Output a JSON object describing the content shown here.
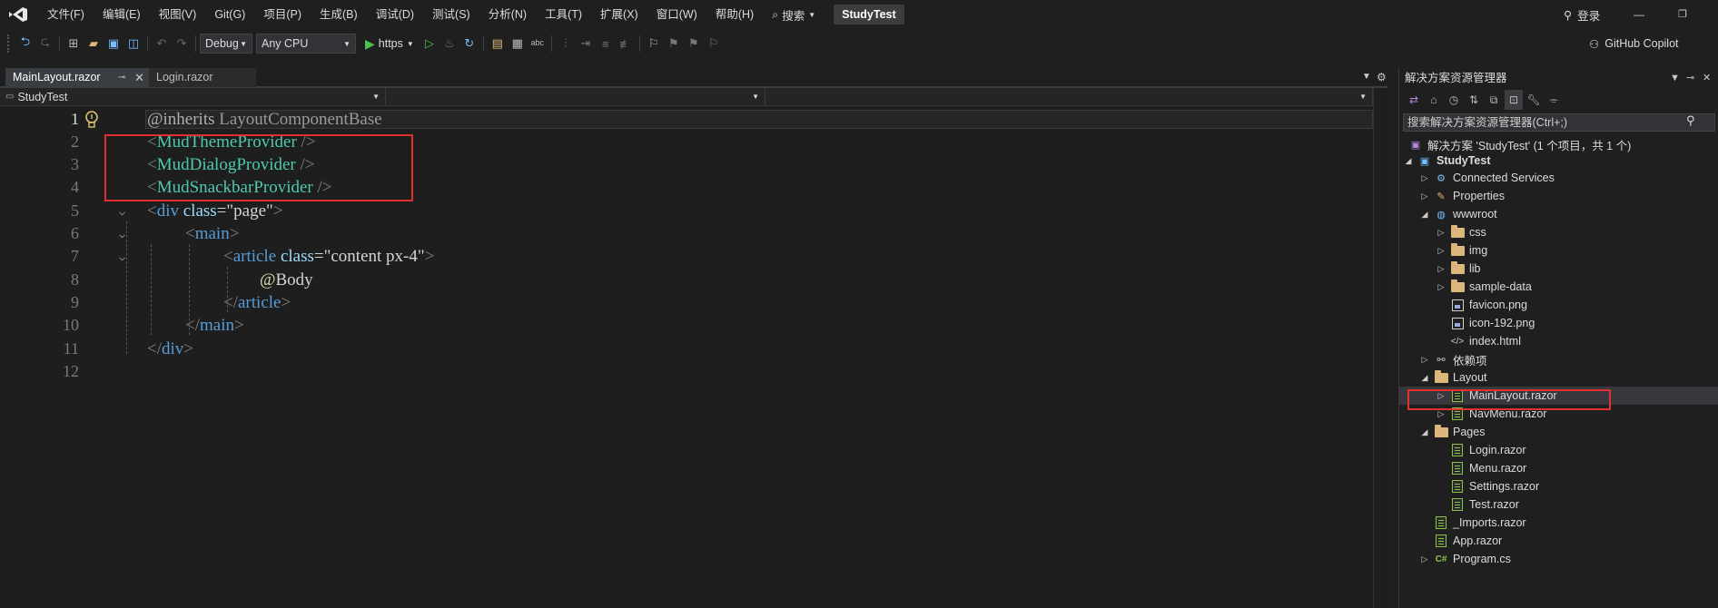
{
  "menubar": {
    "items": [
      "文件(F)",
      "编辑(E)",
      "视图(V)",
      "Git(G)",
      "项目(P)",
      "生成(B)",
      "调试(D)",
      "测试(S)",
      "分析(N)",
      "工具(T)",
      "扩展(X)",
      "窗口(W)",
      "帮助(H)"
    ],
    "search_label": "搜索",
    "solution_name": "StudyTest",
    "login_label": "登录"
  },
  "toolbar": {
    "config": "Debug",
    "platform": "Any CPU",
    "run_target": "https",
    "copilot_label": "GitHub Copilot"
  },
  "editor": {
    "tabs": [
      {
        "label": "MainLayout.razor",
        "active": true
      },
      {
        "label": "Login.razor",
        "active": false
      }
    ],
    "nav_project": "StudyTest",
    "line_numbers": [
      "1",
      "2",
      "3",
      "4",
      "5",
      "6",
      "7",
      "8",
      "9",
      "10",
      "11",
      "12"
    ],
    "code": {
      "l1_directive": "@inherits",
      "l1_type": "LayoutComponentBase",
      "l2_tag": "MudThemeProvider",
      "l3_tag": "MudDialogProvider",
      "l4_tag": "MudSnackbarProvider",
      "l5_tag": "div",
      "l5_attr": "class",
      "l5_value": "page",
      "l6_tag": "main",
      "l7_tag": "article",
      "l7_attr": "class",
      "l7_value": "content px-4",
      "l8_body": "Body",
      "l9_tag": "article",
      "l10_tag": "main",
      "l11_tag": "div"
    }
  },
  "solution_explorer": {
    "title": "解决方案资源管理器",
    "search_placeholder": "搜索解决方案资源管理器(Ctrl+;)",
    "solution_label": "解决方案 'StudyTest' (1 个项目，共 1 个)",
    "project_label": "StudyTest",
    "items": {
      "connected_services": "Connected Services",
      "properties": "Properties",
      "wwwroot": "wwwroot",
      "css": "css",
      "img": "img",
      "lib": "lib",
      "sample_data": "sample-data",
      "favicon": "favicon.png",
      "icon192": "icon-192.png",
      "index_html": "index.html",
      "deps": "依赖项",
      "layout": "Layout",
      "main_layout": "MainLayout.razor",
      "nav_menu": "NavMenu.razor",
      "pages": "Pages",
      "login": "Login.razor",
      "menu": "Menu.razor",
      "settings": "Settings.razor",
      "test": "Test.razor",
      "imports": "_Imports.razor",
      "app": "App.razor",
      "program": "Program.cs"
    }
  },
  "colors": {
    "highlight_box": "#e03030",
    "tag_color": "#4ec9b0",
    "html_tag_color": "#569cd6"
  }
}
